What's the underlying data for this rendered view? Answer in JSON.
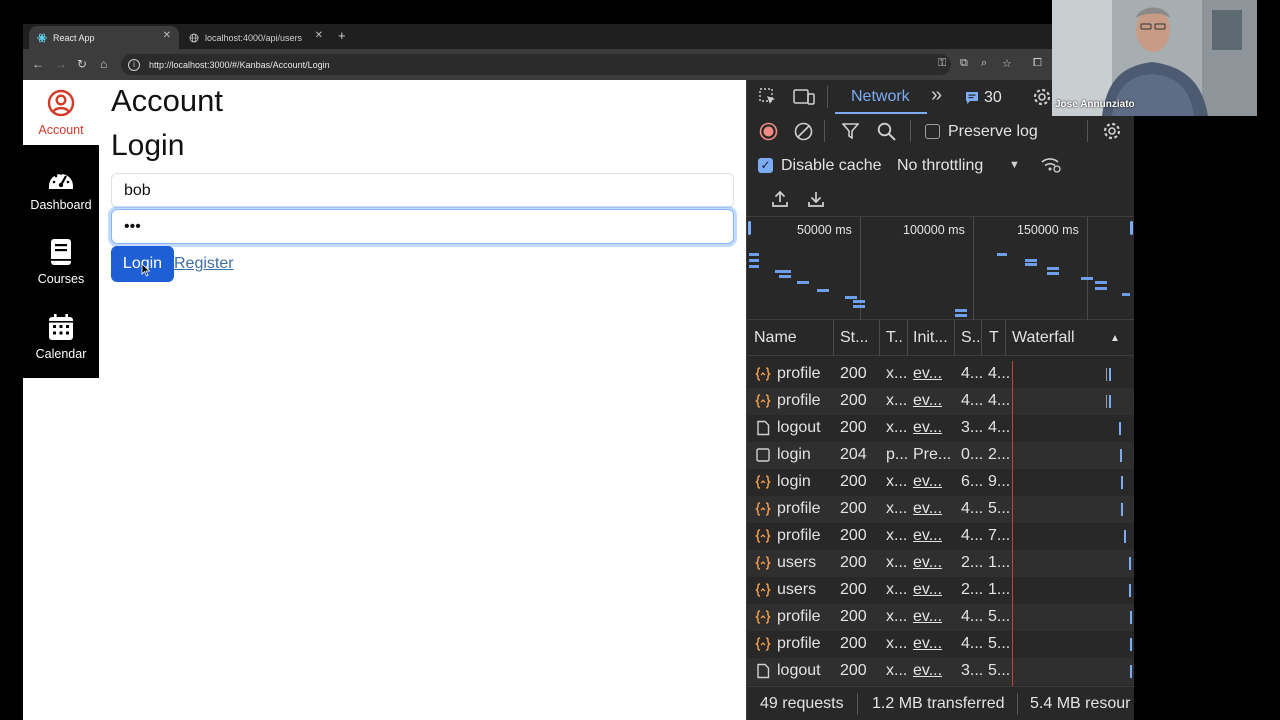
{
  "browser": {
    "tabs": [
      {
        "title": "React App",
        "active": true
      },
      {
        "title": "localhost:4000/api/users",
        "active": false
      }
    ],
    "url": "http://localhost:3000/#/Kanbas/Account/Login"
  },
  "kanbas_nav": [
    {
      "label": "Account",
      "icon": "account-circle-icon",
      "active": true
    },
    {
      "label": "Dashboard",
      "icon": "speedometer-icon",
      "active": false
    },
    {
      "label": "Courses",
      "icon": "book-icon",
      "active": false
    },
    {
      "label": "Calendar",
      "icon": "calendar-icon",
      "active": false
    }
  ],
  "main": {
    "heading": "Account",
    "subheading": "Login",
    "username_value": "bob",
    "password_value": "•••",
    "login_button": "Login",
    "register_link": "Register"
  },
  "devtools": {
    "active_tab": "Network",
    "more_tabs": "»",
    "issues_count": "30",
    "preserve_log_label": "Preserve log",
    "disable_cache_label": "Disable cache",
    "disable_cache_checked": true,
    "throttling": "No throttling",
    "timeline_ticks": [
      "50000 ms",
      "100000 ms",
      "150000 ms"
    ],
    "columns": [
      "Name",
      "St...",
      "T..",
      "Init...",
      "S..",
      "T",
      "Waterfall"
    ],
    "rows": [
      {
        "icon": "fetch",
        "name": "profile",
        "status": "200",
        "type": "x...",
        "initiator": "ev...",
        "size": "4...",
        "time": "4..."
      },
      {
        "icon": "fetch",
        "name": "profile",
        "status": "200",
        "type": "x...",
        "initiator": "ev...",
        "size": "4...",
        "time": "4..."
      },
      {
        "icon": "doc",
        "name": "logout",
        "status": "200",
        "type": "x...",
        "initiator": "ev...",
        "size": "3...",
        "time": "4..."
      },
      {
        "icon": "box",
        "name": "login",
        "status": "204",
        "type": "p...",
        "initiator": "Pre...",
        "size": "0...",
        "time": "2..."
      },
      {
        "icon": "fetch",
        "name": "login",
        "status": "200",
        "type": "x...",
        "initiator": "ev...",
        "size": "6...",
        "time": "9..."
      },
      {
        "icon": "fetch",
        "name": "profile",
        "status": "200",
        "type": "x...",
        "initiator": "ev...",
        "size": "4...",
        "time": "5..."
      },
      {
        "icon": "fetch",
        "name": "profile",
        "status": "200",
        "type": "x...",
        "initiator": "ev...",
        "size": "4...",
        "time": "7..."
      },
      {
        "icon": "fetch",
        "name": "users",
        "status": "200",
        "type": "x...",
        "initiator": "ev...",
        "size": "2...",
        "time": "1..."
      },
      {
        "icon": "fetch",
        "name": "users",
        "status": "200",
        "type": "x...",
        "initiator": "ev...",
        "size": "2...",
        "time": "1..."
      },
      {
        "icon": "fetch",
        "name": "profile",
        "status": "200",
        "type": "x...",
        "initiator": "ev...",
        "size": "4...",
        "time": "5..."
      },
      {
        "icon": "fetch",
        "name": "profile",
        "status": "200",
        "type": "x...",
        "initiator": "ev...",
        "size": "4...",
        "time": "5..."
      },
      {
        "icon": "doc",
        "name": "logout",
        "status": "200",
        "type": "x...",
        "initiator": "ev...",
        "size": "3...",
        "time": "5..."
      }
    ],
    "status": {
      "requests": "49 requests",
      "transferred": "1.2 MB transferred",
      "resources": "5.4 MB resour"
    }
  },
  "webcam": {
    "name": "Jose Annunziato"
  }
}
